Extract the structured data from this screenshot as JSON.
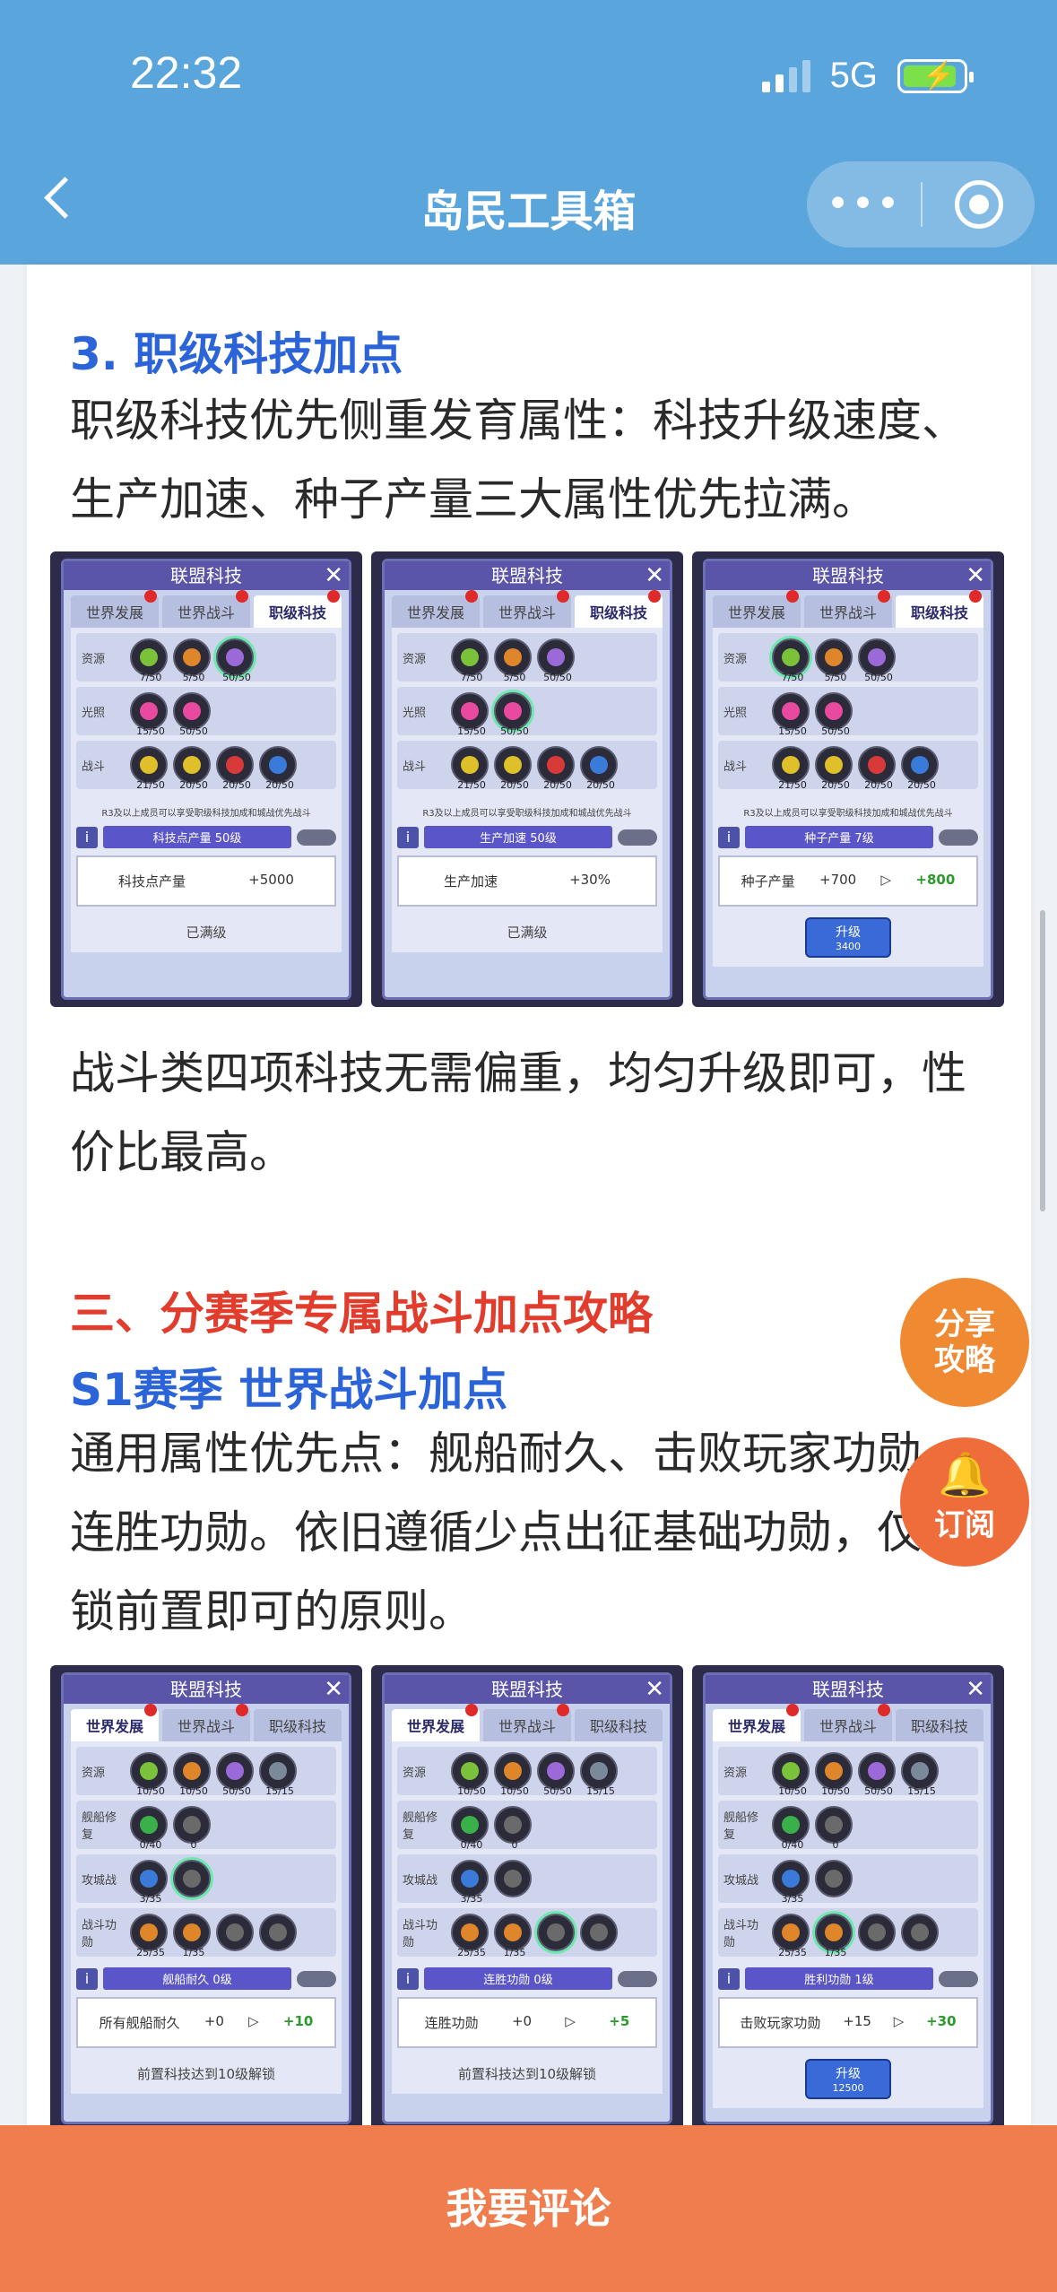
{
  "status": {
    "time": "22:32",
    "network": "5G"
  },
  "nav": {
    "title": "岛民工具箱",
    "more": "•••"
  },
  "sections": {
    "h3_rank": "3. 职级科技加点",
    "p_rank_1": "职级科技优先侧重发育属性：科技升级速度、",
    "p_rank_2": "生产加速、种子产量三大属性优先拉满。",
    "p_battle_1": "战斗类四项科技无需偏重，均匀升级即可，性",
    "p_battle_2": "价比最高。",
    "h2_season": "三、分赛季专属战斗加点攻略",
    "h3_s1": "S1赛季 世界战斗加点",
    "p_s1_1": "通用属性优先点：舰船耐久、击败玩家功勋",
    "p_s1_2": "连胜功勋。依旧遵循少点出征基础功勋，仅",
    "p_s1_3": "锁前置即可的原则。"
  },
  "panel_common": {
    "title": "联盟科技",
    "tab_dev": "世界发展",
    "tab_battle": "世界战斗",
    "tab_rank": "职级科技",
    "row_resource": "资源",
    "row_light": "光照",
    "row_fight": "战斗",
    "note": "R3及以上成员可以享受职级科技加成和城战优先战斗",
    "info": "i",
    "maxed": "已满级",
    "upgrade": "升级",
    "row_ship": "舰船修复",
    "row_attack": "攻城战",
    "row_merit": "战斗功勋",
    "unlock": "前置科技达到10级解锁"
  },
  "panels_top": [
    {
      "counts": [
        "7/50",
        "5/50",
        "50/50"
      ],
      "light": [
        "15/50",
        "50/50"
      ],
      "fight": [
        "21/50",
        "20/50",
        "20/50",
        "20/50"
      ],
      "name": "科技点产量 50级",
      "stat_label": "科技点产量",
      "stat_val": "+5000",
      "stat_next": "",
      "footer": "已满级"
    },
    {
      "counts": [
        "7/50",
        "5/50",
        "50/50"
      ],
      "light": [
        "15/50",
        "50/50"
      ],
      "fight": [
        "21/50",
        "20/50",
        "20/50",
        "20/50"
      ],
      "name": "生产加速 50级",
      "stat_label": "生产加速",
      "stat_val": "+30%",
      "stat_next": "",
      "footer": "已满级"
    },
    {
      "counts": [
        "7/50",
        "5/50",
        "50/50"
      ],
      "light": [
        "15/50",
        "50/50"
      ],
      "fight": [
        "21/50",
        "20/50",
        "20/50",
        "20/50"
      ],
      "name": "种子产量 7级",
      "stat_label": "种子产量",
      "stat_val": "+700",
      "stat_next": "+800",
      "cost": "3400"
    }
  ],
  "panels_bottom": [
    {
      "res": [
        "10/50",
        "10/50",
        "50/50",
        "15/15"
      ],
      "ship": [
        "0/40",
        "0"
      ],
      "atk": [
        "3/35",
        ""
      ],
      "merit": [
        "25/35",
        "1/35",
        "",
        ""
      ],
      "name": "舰船耐久 0级",
      "stat_label": "所有舰船耐久",
      "stat_val": "+0",
      "stat_next": "+10",
      "footer": "前置科技达到10级解锁"
    },
    {
      "res": [
        "10/50",
        "10/50",
        "50/50",
        "15/15"
      ],
      "ship": [
        "0/40",
        "0"
      ],
      "atk": [
        "3/35",
        ""
      ],
      "merit": [
        "25/35",
        "1/35",
        "",
        ""
      ],
      "name": "连胜功勋 0级",
      "stat_label": "连胜功勋",
      "stat_val": "+0",
      "stat_next": "+5",
      "footer": "前置科技达到10级解锁"
    },
    {
      "res": [
        "10/50",
        "10/50",
        "50/50",
        "15/15"
      ],
      "ship": [
        "0/40",
        "0"
      ],
      "atk": [
        "3/35",
        ""
      ],
      "merit": [
        "25/35",
        "1/35",
        "",
        ""
      ],
      "name": "胜利功勋 1级",
      "stat_label": "击败玩家功勋",
      "stat_val": "+15",
      "stat_next": "+30",
      "cost": "12500"
    }
  ],
  "floats": {
    "share_1": "分享",
    "share_2": "攻略",
    "subscribe": "订阅"
  },
  "bottom": {
    "comment": "我要评论"
  },
  "colors": {
    "header": "#5aa5dc",
    "heading_blue": "#2b64d8",
    "heading_red": "#e23c2d",
    "bottom_bar": "#ef7d4e"
  }
}
